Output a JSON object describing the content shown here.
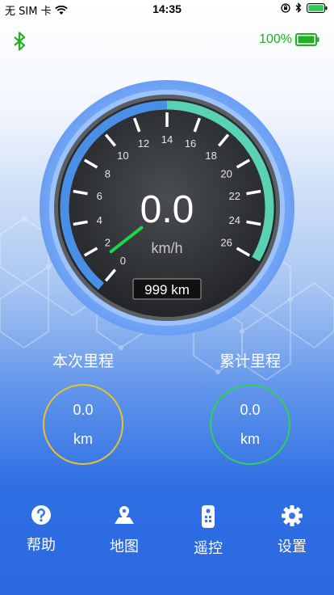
{
  "status_bar": {
    "carrier": "无 SIM 卡",
    "time": "14:35"
  },
  "top": {
    "battery_text": "100%",
    "battery_level": 1.0,
    "accent_green": "#1fb11f"
  },
  "speedometer": {
    "speed": "0.0",
    "unit": "km/h",
    "range": "999 km",
    "ticks": [
      "0",
      "2",
      "4",
      "6",
      "8",
      "10",
      "12",
      "14",
      "16",
      "18",
      "20",
      "22",
      "24",
      "26"
    ],
    "needle_value": 0
  },
  "trip": {
    "left": {
      "label": "本次里程",
      "value": "0.0",
      "unit": "km",
      "ring_color": "#e6c22f"
    },
    "right": {
      "label": "累计里程",
      "value": "0.0",
      "unit": "km",
      "ring_color": "#2ed05a"
    }
  },
  "nav": {
    "items": [
      {
        "label": "帮助",
        "icon": "help-icon"
      },
      {
        "label": "地图",
        "icon": "map-icon"
      },
      {
        "label": "遥控",
        "icon": "remote-icon"
      },
      {
        "label": "设置",
        "icon": "gear-icon"
      }
    ]
  }
}
